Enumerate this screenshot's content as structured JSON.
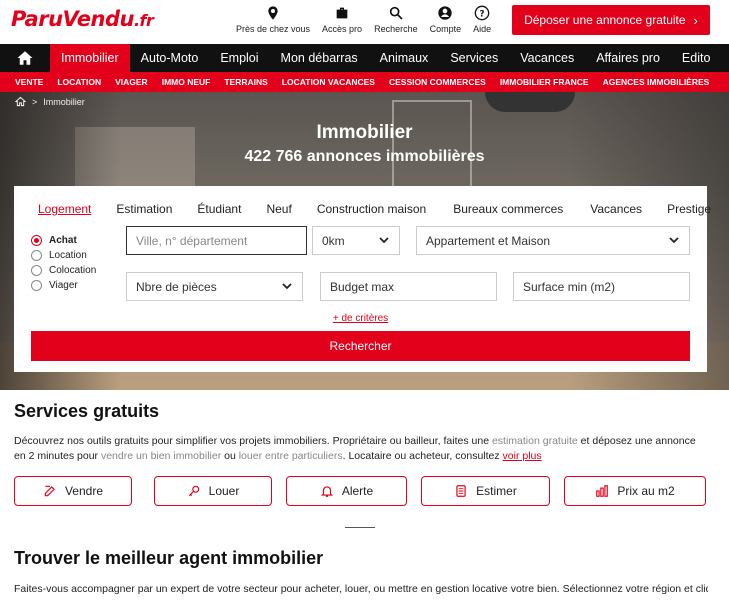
{
  "brand": {
    "name": "ParuVendu",
    "tld": ".fr",
    "color": "#e2001a"
  },
  "top_links": [
    {
      "label": "Près de chez vous",
      "icon": "map-pin-icon"
    },
    {
      "label": "Accès pro",
      "icon": "briefcase-icon"
    },
    {
      "label": "Recherche",
      "icon": "search-icon"
    },
    {
      "label": "Compte",
      "icon": "user-icon"
    },
    {
      "label": "Aide",
      "icon": "help-icon"
    }
  ],
  "cta": {
    "label": "Déposer une annonce gratuite",
    "icon": "chevron-right-icon"
  },
  "main_nav": {
    "home_icon": "home-icon",
    "items": [
      "Immobilier",
      "Auto-Moto",
      "Emploi",
      "Mon débarras",
      "Animaux",
      "Services",
      "Vacances",
      "Affaires pro",
      "Edito"
    ],
    "active": "Immobilier"
  },
  "sub_nav": [
    "VENTE",
    "LOCATION",
    "VIAGER",
    "IMMO NEUF",
    "TERRAINS",
    "LOCATION VACANCES",
    "CESSION COMMERCES",
    "IMMOBILIER FRANCE",
    "AGENCES IMMOBILIÈRES"
  ],
  "breadcrumb": {
    "home_icon": "home-icon",
    "separator": ">",
    "current": "Immobilier"
  },
  "hero": {
    "title": "Immobilier",
    "subtitle": "422 766 annonces immobilières"
  },
  "search": {
    "tabs": [
      "Logement",
      "Estimation",
      "Étudiant",
      "Neuf",
      "Construction maison",
      "Bureaux commerces",
      "Vacances",
      "Prestige"
    ],
    "active_tab": "Logement",
    "radios": [
      "Achat",
      "Location",
      "Colocation",
      "Viager"
    ],
    "selected_radio": "Achat",
    "location_placeholder": "Ville, n° département",
    "radius_value": "0km",
    "type_value": "Appartement et Maison",
    "rooms_value": "Nbre de pièces",
    "budget_placeholder": "Budget max",
    "surface_placeholder": "Surface min (m2)",
    "more_criteria": "+ de critères",
    "submit": "Rechercher"
  },
  "services": {
    "title": "Services gratuits",
    "text_1": "Découvrez nos outils gratuits pour simplifier vos projets immobiliers. Propriétaire ou bailleur, faites une ",
    "link_estimation": "estimation gratuite",
    "text_2": " et déposez une annonce en 2 minutes pour ",
    "link_vendre": "vendre un bien immobilier",
    "text_3": " ou ",
    "link_louer": "louer entre particuliers",
    "text_4": ". Locataire ou acheteur, consultez ",
    "link_voir": "voir plus",
    "buttons": [
      {
        "label": "Vendre",
        "icon": "edit-icon"
      },
      {
        "label": "Louer",
        "icon": "key-icon"
      },
      {
        "label": "Alerte",
        "icon": "bell-icon"
      },
      {
        "label": "Estimer",
        "icon": "calculator-icon"
      },
      {
        "label": "Prix au m2",
        "icon": "bar-chart-icon"
      }
    ]
  },
  "agent": {
    "title": "Trouver le meilleur agent immobilier",
    "text": "Faites-vous accompagner par un expert de votre secteur pour acheter, louer, ou mettre en gestion locative votre bien. Sélectionnez votre région et cliquez sur"
  }
}
